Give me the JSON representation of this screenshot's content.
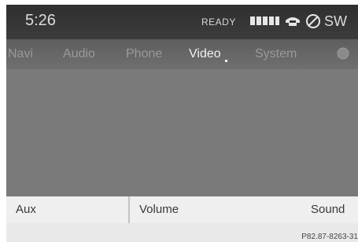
{
  "status": {
    "time": "5:26",
    "ready": "READY",
    "signal_icon": "signal-bars-icon",
    "phone_icon": "phone-icon",
    "clock_icon": "no-time-icon",
    "sw": "SW"
  },
  "menu": {
    "items": [
      {
        "label": "Navi",
        "active": false
      },
      {
        "label": "Audio",
        "active": false
      },
      {
        "label": "Phone",
        "active": false
      },
      {
        "label": "Video",
        "active": true
      },
      {
        "label": "System",
        "active": false
      }
    ],
    "globe_icon": "globe-icon"
  },
  "softkeys": {
    "left": "Aux",
    "middle": "Volume",
    "right": "Sound"
  },
  "reference": "P82.87-8263-31",
  "colors": {
    "status_bg": "#363636",
    "menu_bg": "#666666",
    "content_bg": "#7a7a7a",
    "softkey_bg": "#efefef",
    "active_text": "#f2f2f2",
    "inactive_text": "#9a9a9a"
  }
}
